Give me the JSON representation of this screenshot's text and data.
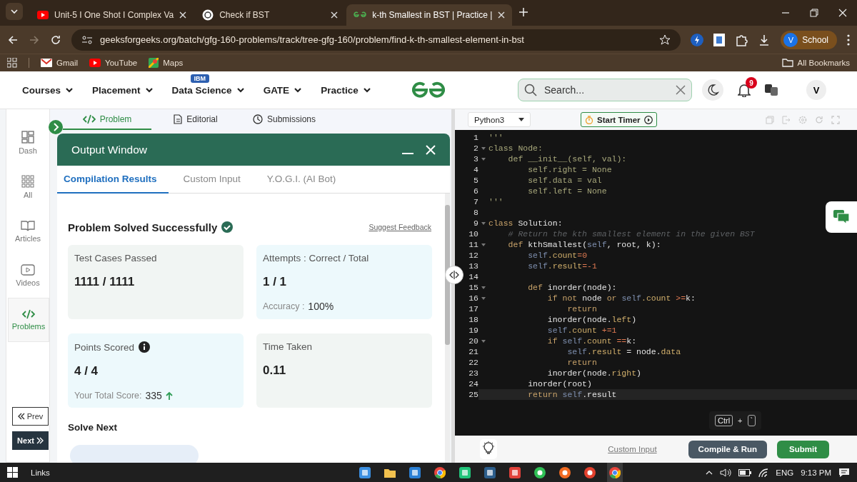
{
  "browser": {
    "tabs": [
      {
        "title": "Unit-5 I One Shot I Complex Va",
        "kind": "video",
        "selected": false
      },
      {
        "title": "Check if BST",
        "kind": "chat",
        "selected": false
      },
      {
        "title": "k-th Smallest in BST | Practice |",
        "kind": "site",
        "selected": true
      }
    ],
    "url": "geeksforgeeks.org/batch/gfg-160-problems/track/tree-gfg-160/problem/find-k-th-smallest-element-in-bst",
    "profile": {
      "initial": "V",
      "label": "School"
    },
    "bookmarks": [
      {
        "label": "Gmail",
        "kind": "mail"
      },
      {
        "label": "YouTube",
        "kind": "video"
      },
      {
        "label": "Maps",
        "kind": "map"
      }
    ],
    "all_bookmarks": "All Bookmarks"
  },
  "header": {
    "nav": [
      {
        "label": "Courses"
      },
      {
        "label": "Placement"
      },
      {
        "label": "Data Science",
        "badge": "IBM"
      },
      {
        "label": "GATE"
      },
      {
        "label": "Practice"
      }
    ],
    "search": {
      "placeholder": "Search..."
    },
    "notifications": "9",
    "avatar": "V"
  },
  "sidebar": {
    "items": [
      {
        "label": "Dash",
        "kind": "dash",
        "selected": false
      },
      {
        "label": "All",
        "kind": "grid",
        "selected": false
      },
      {
        "label": "Articles",
        "kind": "book",
        "selected": false
      },
      {
        "label": "Videos",
        "kind": "video",
        "selected": false
      },
      {
        "label": "Problems",
        "kind": "code",
        "selected": true
      }
    ],
    "prev": "Prev",
    "next": "Next"
  },
  "problem_tabs": [
    {
      "label": "Problem",
      "kind": "code",
      "selected": true
    },
    {
      "label": "Editorial",
      "kind": "doc",
      "selected": false
    },
    {
      "label": "Submissions",
      "kind": "clock",
      "selected": false
    }
  ],
  "output_window": {
    "title": "Output Window",
    "tabs": [
      {
        "label": "Compilation Results",
        "selected": true
      },
      {
        "label": "Custom Input",
        "selected": false
      },
      {
        "label": "Y.O.G.I. (AI Bot)",
        "selected": false
      }
    ],
    "status": "Problem Solved Successfully",
    "feedback_link": "Suggest Feedback",
    "cards": [
      {
        "label": "Test Cases Passed",
        "value": "1111 / 1111",
        "color": "#f1f5f3",
        "info_icon": false,
        "trend_up": false
      },
      {
        "label": "Attempts : Correct / Total",
        "value": "1 / 1",
        "sub_label": "Accuracy :",
        "sub_value": "100%",
        "color": "#edf9fc",
        "info_icon": false,
        "trend_up": false
      },
      {
        "label": "Points Scored",
        "value": "4 / 4",
        "sub_label": "Your Total Score:",
        "sub_value": "335",
        "trend_up": true,
        "color": "#edf9fc",
        "info_icon": true
      },
      {
        "label": "Time Taken",
        "value": "0.11",
        "color": "#f1f5f3",
        "info_icon": false,
        "trend_up": false
      }
    ],
    "solve_next": "Solve Next"
  },
  "editor": {
    "language": "Python3",
    "timer_button": "Start Timer",
    "lines": [
      {
        "number": "1",
        "foldable": false,
        "active": false,
        "tokens": [
          {
            "kind": "string",
            "text": "'''"
          }
        ]
      },
      {
        "number": "2",
        "foldable": true,
        "active": false,
        "tokens": [
          {
            "kind": "string",
            "text": "class Node:"
          }
        ]
      },
      {
        "number": "3",
        "foldable": true,
        "active": false,
        "tokens": [
          {
            "kind": "string",
            "text": "    def __init__(self, val):"
          }
        ]
      },
      {
        "number": "4",
        "foldable": false,
        "active": false,
        "tokens": [
          {
            "kind": "string",
            "text": "        self.right = None"
          }
        ]
      },
      {
        "number": "5",
        "foldable": false,
        "active": false,
        "tokens": [
          {
            "kind": "string",
            "text": "        self.data = val"
          }
        ]
      },
      {
        "number": "6",
        "foldable": false,
        "active": false,
        "tokens": [
          {
            "kind": "string",
            "text": "        self.left = None"
          }
        ]
      },
      {
        "number": "7",
        "foldable": false,
        "active": false,
        "tokens": [
          {
            "kind": "string",
            "text": "'''"
          }
        ]
      },
      {
        "number": "8",
        "foldable": false,
        "active": false
      },
      {
        "number": "9",
        "foldable": true,
        "active": false,
        "tokens": [
          {
            "kind": "keyword",
            "text": "class"
          },
          {
            "kind": "name",
            "text": " Solution:"
          }
        ]
      },
      {
        "number": "10",
        "foldable": false,
        "active": false,
        "tokens": [
          {
            "kind": "comment",
            "text": "    # Return the kth smallest element in the given BST"
          }
        ]
      },
      {
        "number": "11",
        "foldable": true,
        "active": false,
        "tokens": [
          {
            "kind": "keyword",
            "text": "    def"
          },
          {
            "kind": "name",
            "text": " kthSmallest("
          },
          {
            "kind": "self",
            "text": "self"
          },
          {
            "kind": "name",
            "text": ", root, k):"
          }
        ]
      },
      {
        "number": "12",
        "foldable": false,
        "active": false,
        "tokens": [
          {
            "kind": "self",
            "text": "        self"
          },
          {
            "kind": "attr",
            "text": ".count"
          },
          {
            "kind": "number",
            "text": "=0"
          }
        ]
      },
      {
        "number": "13",
        "foldable": false,
        "active": false,
        "tokens": [
          {
            "kind": "self",
            "text": "        self"
          },
          {
            "kind": "attr",
            "text": ".result"
          },
          {
            "kind": "number",
            "text": "=-1"
          }
        ]
      },
      {
        "number": "14",
        "foldable": false,
        "active": false
      },
      {
        "number": "15",
        "foldable": true,
        "active": false,
        "tokens": [
          {
            "kind": "keyword",
            "text": "        def"
          },
          {
            "kind": "name",
            "text": " inorder(node):"
          }
        ]
      },
      {
        "number": "16",
        "foldable": true,
        "active": false,
        "tokens": [
          {
            "kind": "keyword",
            "text": "            if not"
          },
          {
            "kind": "name",
            "text": " node "
          },
          {
            "kind": "keyword",
            "text": "or "
          },
          {
            "kind": "self",
            "text": "self"
          },
          {
            "kind": "attr",
            "text": ".count "
          },
          {
            "kind": "number",
            "text": ">="
          },
          {
            "kind": "name",
            "text": "k:"
          }
        ]
      },
      {
        "number": "17",
        "foldable": false,
        "active": false,
        "tokens": [
          {
            "kind": "keyword",
            "text": "                return"
          }
        ]
      },
      {
        "number": "18",
        "foldable": false,
        "active": false,
        "tokens": [
          {
            "kind": "name",
            "text": "            inorder(node."
          },
          {
            "kind": "attr",
            "text": "left"
          },
          {
            "kind": "name",
            "text": ")"
          }
        ]
      },
      {
        "number": "19",
        "foldable": false,
        "active": false,
        "tokens": [
          {
            "kind": "self",
            "text": "            self"
          },
          {
            "kind": "attr",
            "text": ".count "
          },
          {
            "kind": "number",
            "text": "+=1"
          }
        ]
      },
      {
        "number": "20",
        "foldable": true,
        "active": false,
        "tokens": [
          {
            "kind": "keyword",
            "text": "            if "
          },
          {
            "kind": "self",
            "text": "self"
          },
          {
            "kind": "attr",
            "text": ".count "
          },
          {
            "kind": "number",
            "text": "=="
          },
          {
            "kind": "name",
            "text": "k:"
          }
        ]
      },
      {
        "number": "21",
        "foldable": false,
        "active": false,
        "tokens": [
          {
            "kind": "self",
            "text": "                self"
          },
          {
            "kind": "attr",
            "text": ".result "
          },
          {
            "kind": "name",
            "text": "= node."
          },
          {
            "kind": "attr",
            "text": "data"
          }
        ]
      },
      {
        "number": "22",
        "foldable": false,
        "active": false,
        "tokens": [
          {
            "kind": "keyword",
            "text": "                return"
          }
        ]
      },
      {
        "number": "23",
        "foldable": false,
        "active": false,
        "tokens": [
          {
            "kind": "name",
            "text": "            inorder(node."
          },
          {
            "kind": "attr",
            "text": "right"
          },
          {
            "kind": "name",
            "text": ")"
          }
        ]
      },
      {
        "number": "24",
        "foldable": false,
        "active": false,
        "tokens": [
          {
            "kind": "name",
            "text": "        inorder(root)"
          }
        ]
      },
      {
        "number": "25",
        "foldable": false,
        "active": true,
        "tokens": [
          {
            "kind": "keyword",
            "text": "        return "
          },
          {
            "kind": "self",
            "text": "self"
          },
          {
            "kind": "name",
            "text": ".result"
          }
        ]
      }
    ],
    "tooltip": {
      "keys": [
        "Ctrl",
        "`"
      ],
      "joiner": "+"
    },
    "custom_input": "Custom Input",
    "compile_button": "Compile & Run",
    "submit_button": "Submit"
  },
  "taskbar": {
    "links": "Links",
    "apps": [
      {
        "kind": "tile",
        "color": "#3b8fe0",
        "selected": false
      },
      {
        "kind": "folder",
        "color": "#f2c14e",
        "selected": false
      },
      {
        "kind": "tile",
        "color": "#2a7fd4",
        "selected": false
      },
      {
        "kind": "chrome",
        "color": "#e8453c",
        "selected": false
      },
      {
        "kind": "tile",
        "color": "#21c47a",
        "selected": false
      },
      {
        "kind": "tile",
        "color": "#2c5d8a",
        "selected": false
      },
      {
        "kind": "tile",
        "color": "#e0413a",
        "selected": false
      },
      {
        "kind": "circle",
        "color": "#2fbf55",
        "selected": false
      },
      {
        "kind": "circle",
        "color": "#f26b22",
        "selected": false
      },
      {
        "kind": "circle",
        "color": "#e2402d",
        "selected": false
      },
      {
        "kind": "chrome",
        "color": "#e8453c",
        "selected": true
      }
    ],
    "language": "ENG",
    "time": "9:13 PM"
  }
}
